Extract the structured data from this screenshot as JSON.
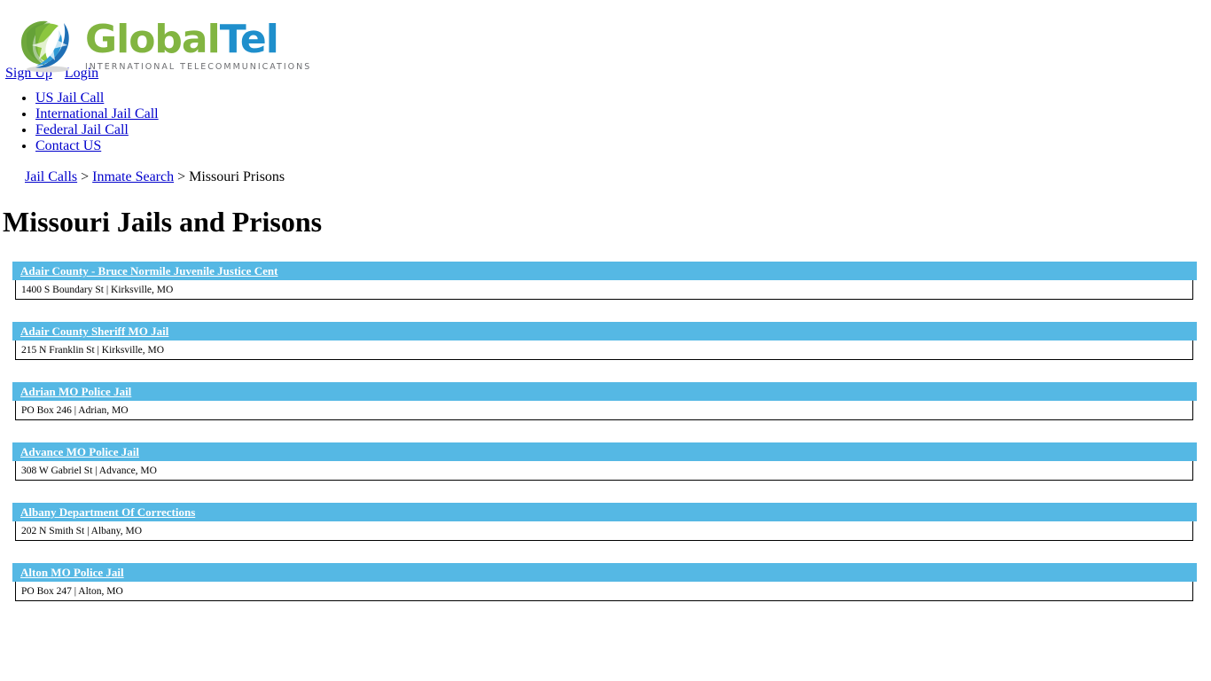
{
  "brand": {
    "name_part1": "Global",
    "name_part2": "Tel",
    "tagline": "INTERNATIONAL TELECOMMUNICATIONS",
    "colors": {
      "green": "#82b541",
      "blue": "#1f8fcc",
      "tagline_gray": "#6d6e71",
      "header_bar": "#55b8e4",
      "link": "#0000cc"
    }
  },
  "account": {
    "sign_up": "Sign Up",
    "login": "Login"
  },
  "nav": {
    "items": [
      {
        "label": "US Jail Call"
      },
      {
        "label": "International Jail Call"
      },
      {
        "label": "Federal Jail Call"
      },
      {
        "label": "Contact US"
      }
    ]
  },
  "breadcrumb": {
    "items": [
      {
        "label": "Jail Calls",
        "link": true
      },
      {
        "label": "Inmate Search",
        "link": true
      },
      {
        "label": "Missouri Prisons",
        "link": false
      }
    ],
    "separator": ">"
  },
  "page": {
    "title": "Missouri Jails and Prisons"
  },
  "facilities": [
    {
      "name": "Adair County - Bruce Normile Juvenile Justice Cent",
      "address": "1400 S Boundary St | Kirksville, MO"
    },
    {
      "name": "Adair County Sheriff MO Jail",
      "address": "215 N Franklin St | Kirksville, MO"
    },
    {
      "name": "Adrian MO Police Jail",
      "address": "PO Box 246 | Adrian, MO"
    },
    {
      "name": "Advance MO Police Jail",
      "address": "308 W Gabriel St | Advance, MO"
    },
    {
      "name": "Albany Department Of Corrections",
      "address": "202 N Smith St | Albany, MO"
    },
    {
      "name": "Alton MO Police Jail",
      "address": "PO Box 247 | Alton, MO"
    }
  ]
}
